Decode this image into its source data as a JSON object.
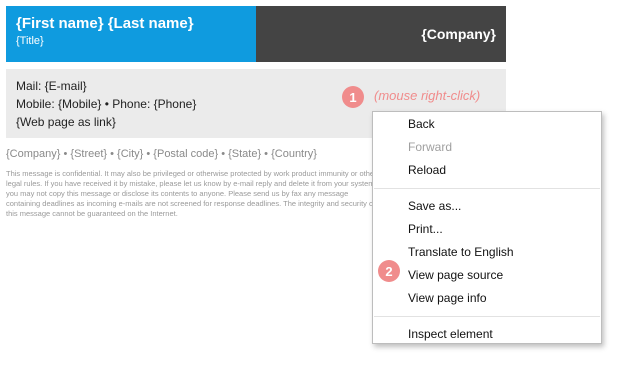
{
  "signature": {
    "name": "{First name} {Last name}",
    "title": "{Title}",
    "company": "{Company}",
    "mail": "Mail: {E-mail}",
    "phones": "Mobile: {Mobile} • Phone: {Phone}",
    "web": "{Web page as link}",
    "address": "{Company} • {Street} • {City} • {Postal code} • {State} • {Country}",
    "disclaimer": "This message is confidential. It may also be privileged or otherwise protected by work product immunity or other legal rules. If you have received it by mistake, please let us know by e-mail reply and delete it from your system; you may not copy this message or disclose its contents to anyone. Please send us by fax any message containing deadlines as incoming e-mails are not screened for response deadlines. The integrity and security of this message cannot be guaranteed on the Internet."
  },
  "annotations": {
    "step1": "1",
    "step1_label": "(mouse right-click)",
    "step2": "2",
    "color": "#f08c8c"
  },
  "context_menu": {
    "back": "Back",
    "forward": "Forward",
    "reload": "Reload",
    "save_as": "Save as...",
    "print": "Print...",
    "translate": "Translate to English",
    "view_source": "View page source",
    "view_info": "View page info",
    "inspect": "Inspect element"
  },
  "colors": {
    "header_blue": "#0f9bdf",
    "header_dark": "#444444",
    "contact_bg": "#ebebeb"
  }
}
